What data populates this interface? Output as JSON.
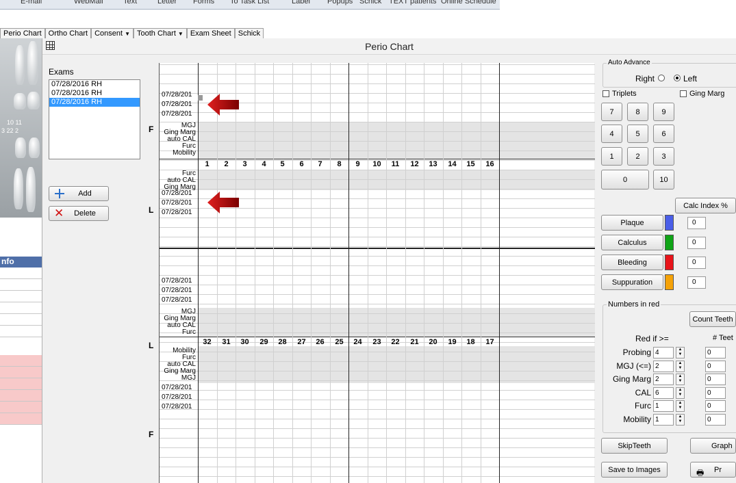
{
  "toolbar": {
    "items": [
      "E-mail",
      "WebMail",
      "Text",
      "Letter",
      "Forms",
      "To Task List",
      "Label",
      "Popups",
      "Schick",
      "TEXT patients",
      "Online Schedule"
    ]
  },
  "tabs": [
    {
      "label": "Perio Chart",
      "dropdown": false
    },
    {
      "label": "Ortho Chart",
      "dropdown": false
    },
    {
      "label": "Consent",
      "dropdown": true
    },
    {
      "label": "Tooth Chart",
      "dropdown": true
    },
    {
      "label": "Exam Sheet",
      "dropdown": false
    },
    {
      "label": "Schick",
      "dropdown": false
    }
  ],
  "left_strip": {
    "tooth_numbers_top": "10  11",
    "tooth_numbers_bottom": "3  22  2",
    "info_header": "nfo"
  },
  "window": {
    "title": "Perio Chart"
  },
  "exams": {
    "label": "Exams",
    "items": [
      {
        "text": "07/28/2016  RH",
        "selected": false
      },
      {
        "text": "07/28/2016  RH",
        "selected": false
      },
      {
        "text": "07/28/2016  RH",
        "selected": true
      }
    ],
    "add_label": "Add",
    "delete_label": "Delete"
  },
  "chart": {
    "date_label": "07/28/201",
    "upper_teeth": [
      "1",
      "2",
      "3",
      "4",
      "5",
      "6",
      "7",
      "8",
      "9",
      "10",
      "11",
      "12",
      "13",
      "14",
      "15",
      "16"
    ],
    "lower_teeth": [
      "32",
      "31",
      "30",
      "29",
      "28",
      "27",
      "26",
      "25",
      "24",
      "23",
      "22",
      "21",
      "20",
      "19",
      "18",
      "17"
    ],
    "facial_label": "F",
    "lingual_label": "L",
    "rows_upper_f": [
      "MGJ",
      "Ging Marg",
      "auto CAL",
      "Furc",
      "Mobility"
    ],
    "rows_upper_l": [
      "Furc",
      "auto CAL",
      "Ging Marg"
    ],
    "rows_lower_l_top": [
      "MGJ",
      "Ging Marg",
      "auto CAL",
      "Furc"
    ],
    "rows_lower_l_bottom": [
      "Mobility",
      "Furc",
      "auto CAL",
      "Ging Marg",
      "MGJ"
    ]
  },
  "auto_advance": {
    "label": "Auto Advance",
    "right_label": "Right",
    "left_label": "Left",
    "selected": "Left"
  },
  "options": {
    "triplets_label": "Triplets",
    "ging_marg_label": "Ging Marg"
  },
  "keypad": [
    "7",
    "8",
    "9",
    "4",
    "5",
    "6",
    "1",
    "2",
    "3",
    "0",
    "10"
  ],
  "calc_index_label": "Calc Index %",
  "indices": [
    {
      "label": "Plaque",
      "value": "0",
      "color": "#4a5ee8"
    },
    {
      "label": "Calculus",
      "value": "0",
      "color": "#0fa416"
    },
    {
      "label": "Bleeding",
      "value": "0",
      "color": "#e8141a"
    },
    {
      "label": "Suppuration",
      "value": "0",
      "color": "#f5a208"
    }
  ],
  "numbers_in_red": {
    "label": "Numbers in red",
    "count_teeth_label": "Count Teeth",
    "red_if_label": "Red if >=",
    "teeth_count_label": "# Teet",
    "rows": [
      {
        "label": "Probing",
        "threshold": "4",
        "count": "0"
      },
      {
        "label": "MGJ (<=)",
        "threshold": "2",
        "count": "0"
      },
      {
        "label": "Ging Marg",
        "threshold": "2",
        "count": "0"
      },
      {
        "label": "CAL",
        "threshold": "6",
        "count": "0"
      },
      {
        "label": "Furc",
        "threshold": "1",
        "count": "0"
      },
      {
        "label": "Mobility",
        "threshold": "1",
        "count": "0"
      }
    ]
  },
  "bottom_buttons": {
    "skip_teeth": "SkipTeeth",
    "graph": "Graph",
    "save_to_images": "Save to Images",
    "print": "Pr"
  }
}
